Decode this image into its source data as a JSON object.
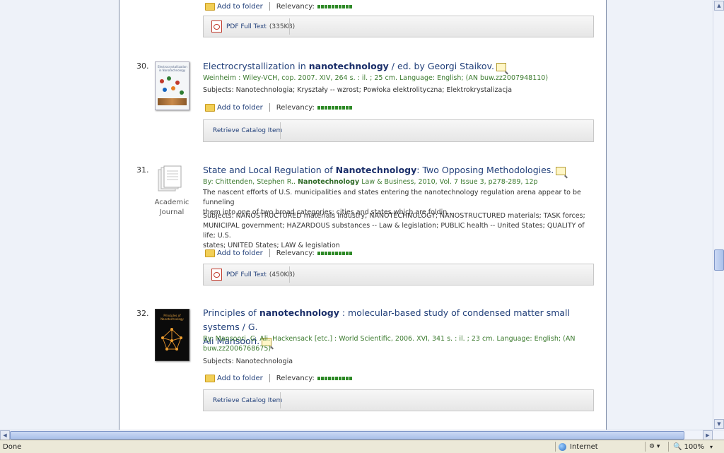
{
  "results": {
    "top_fragment": {
      "add_to_folder": "Add to folder",
      "relevancy_label": "Relevancy:",
      "pdf_label": "PDF Full Text",
      "pdf_size": "(335KB)"
    },
    "item30": {
      "number": "30.",
      "title_pre": "Electrocrystallization in ",
      "title_bold": "nanotechnology",
      "title_post": " / ed. by Georgi Staikov.",
      "meta": "Weinheim : Wiley-VCH, cop. 2007. XIV, 264 s. : il. ; 25 cm. Language: English; (AN buw.zz2007948110)",
      "subjects": "Subjects: Nanotechnologia; Kryształy -- wzrost; Powłoka elektrolityczna; Elektrokrystalizacja",
      "add_to_folder": "Add to folder",
      "relevancy_label": "Relevancy:",
      "panel_link": "Retrieve Catalog Item",
      "cover_title": "Electrocrystallization in Nanotechnology"
    },
    "item31": {
      "number": "31.",
      "title_pre": "State and Local Regulation of ",
      "title_bold": "Nanotechnology",
      "title_post": ": Two Opposing Methodologies.",
      "meta_author": "By: Chittenden, Stephen R.. ",
      "meta_source_bold": "Nanotechnology",
      "meta_source": " Law & Business, 2010, Vol. 7 Issue 3, p278-289, 12p",
      "abstract_1": "The nascent efforts of U.S. municipalities and states entering the nanotechnology regulation arena appear to be funneling",
      "abstract_2": "them into one of two broad categories: cities and states which are foldin...",
      "subjects_1": "Subjects: NANOSTRUCTURED materials industry; NANOTECHNOLOGY; NANOSTRUCTURED materials; TASK forces;",
      "subjects_2": "MUNICIPAL government; HAZARDOUS substances -- Law & legislation; PUBLIC health -- United States; QUALITY of life; U.S.",
      "subjects_3": "states; UNITED States; LAW & legislation",
      "doc_type_1": "Academic",
      "doc_type_2": "Journal",
      "add_to_folder": "Add to folder",
      "relevancy_label": "Relevancy:",
      "pdf_label": "PDF Full Text",
      "pdf_size": "(450KB)"
    },
    "item32": {
      "number": "32.",
      "title_pre": "Principles of ",
      "title_bold": "nanotechnology",
      "title_post": " : molecular-based study of condensed matter small systems / G.",
      "title_line2": "Ali Mansoori.",
      "meta_1": "By: Mansoori, G. Ali. Hackensack [etc.] : World Scientific, 2006. XVI, 341 s. : il. ; 23 cm. Language: English; (AN",
      "meta_2": "buw.zz2006768675)",
      "subjects": "Subjects: Nanotechnologia",
      "add_to_folder": "Add to folder",
      "relevancy_label": "Relevancy:",
      "panel_link": "Retrieve Catalog Item",
      "cover_title": "Principles of Nanotechnology"
    }
  },
  "status_bar": {
    "status": "Done",
    "zone": "Internet",
    "zoom": "100%"
  },
  "colors": {
    "link": "#22407a",
    "meta_green": "#3b7a2e",
    "relevancy": "#2f8a28"
  }
}
